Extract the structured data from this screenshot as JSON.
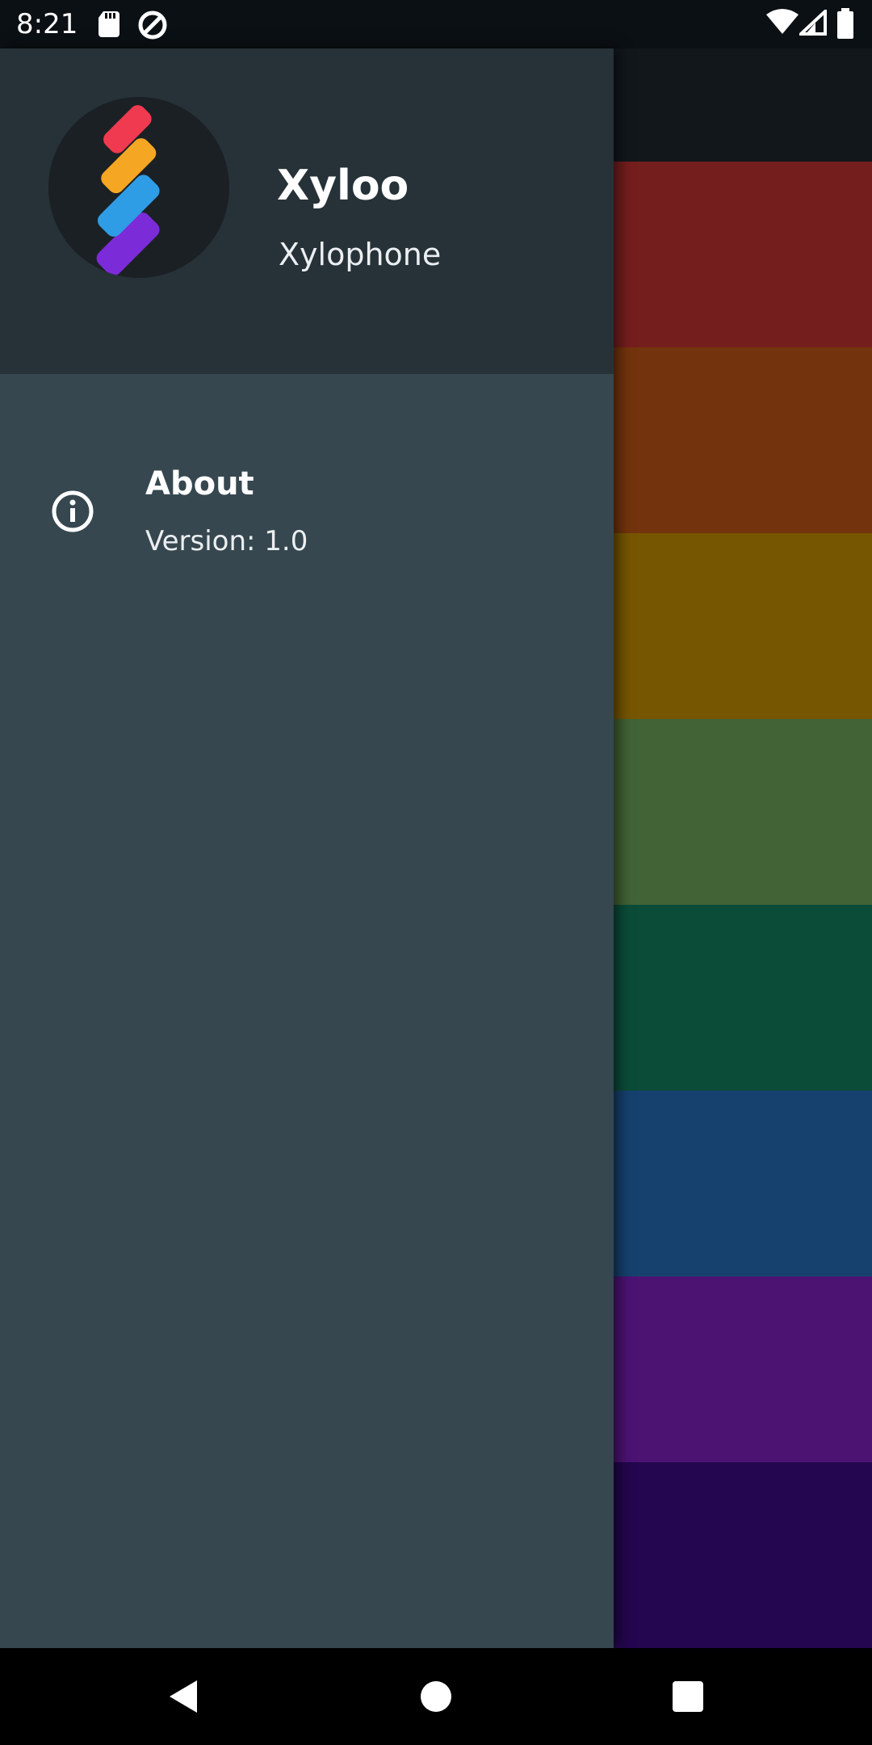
{
  "status_bar": {
    "time": "8:21",
    "left_icons": [
      "sd-card-icon",
      "data-saver-icon"
    ],
    "right_icons": [
      "wifi-icon",
      "signal-icon",
      "battery-icon"
    ]
  },
  "drawer": {
    "header": {
      "app_name": "Xyloo",
      "subtitle": "Xylophone",
      "logo_icon": "xylophone-logo-icon"
    },
    "menu": [
      {
        "icon": "info-icon",
        "title": "About",
        "subtitle": "Version: 1.0"
      }
    ]
  },
  "background_keys": [
    {
      "color": "#a32a2a"
    },
    {
      "color": "#a04812"
    },
    {
      "color": "#a57800"
    },
    {
      "color": "#5b8a4a"
    },
    {
      "color": "#0f6a4f"
    },
    {
      "color": "#1f5a9a"
    },
    {
      "color": "#6a1aa0"
    },
    {
      "color": "#30086e"
    }
  ],
  "nav_bar": {
    "buttons": [
      "back-icon",
      "home-icon",
      "recents-icon"
    ]
  },
  "colors": {
    "drawer_header": "#263238",
    "drawer_body": "#36474f",
    "status_bar": "#0b1014"
  }
}
